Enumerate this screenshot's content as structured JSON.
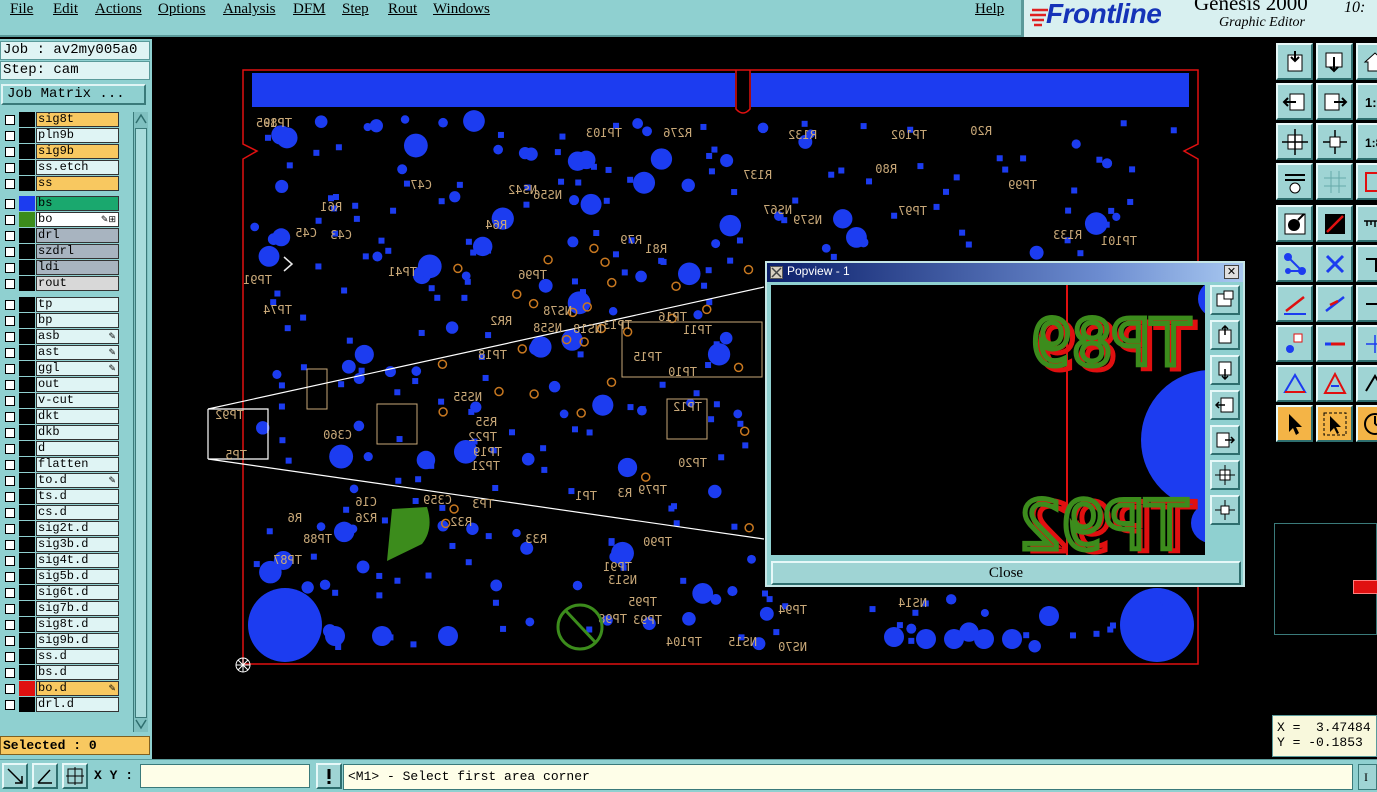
{
  "menu": {
    "items": [
      "File",
      "Edit",
      "Actions",
      "Options",
      "Analysis",
      "DFM",
      "Step",
      "Rout",
      "Windows"
    ],
    "help": "Help"
  },
  "branding": {
    "logo": "Frontline",
    "product": "Genesis 2000",
    "subtitle": "Graphic Editor",
    "clock": "10:"
  },
  "job": {
    "job_line": "Job : av2my005a0",
    "step_line": "Step: cam",
    "matrix_button": "Job Matrix ..."
  },
  "layers": [
    {
      "name": "sig8t",
      "bg": "#f8c860",
      "swatch": "",
      "mark": ""
    },
    {
      "name": "pln9b",
      "bg": "#dff4f4",
      "swatch": "",
      "mark": ""
    },
    {
      "name": "sig9b",
      "bg": "#f8c860",
      "swatch": "",
      "mark": ""
    },
    {
      "name": "ss.etch",
      "bg": "#dff4f4",
      "swatch": "",
      "mark": ""
    },
    {
      "name": "ss",
      "bg": "#f8c860",
      "swatch": "",
      "mark": ""
    },
    {
      "name": "bs",
      "bg": "#1aa86e",
      "swatch": "#1c3cf0",
      "mark": ""
    },
    {
      "name": "bo",
      "bg": "#ffffff",
      "swatch": "#3c8c1c",
      "mark": "✎⊞"
    },
    {
      "name": "drl",
      "bg": "#a8b4c0",
      "swatch": "",
      "mark": ""
    },
    {
      "name": "szdrl",
      "bg": "#a8b4c0",
      "swatch": "",
      "mark": ""
    },
    {
      "name": "ldi",
      "bg": "#a8b4c0",
      "swatch": "",
      "mark": ""
    },
    {
      "name": "rout",
      "bg": "#d8d8d8",
      "swatch": "",
      "mark": ""
    },
    {
      "name": "tp",
      "bg": "#dff4f4",
      "swatch": "",
      "mark": ""
    },
    {
      "name": "bp",
      "bg": "#dff4f4",
      "swatch": "",
      "mark": ""
    },
    {
      "name": "asb",
      "bg": "#dff4f4",
      "swatch": "",
      "mark": "✎"
    },
    {
      "name": "ast",
      "bg": "#dff4f4",
      "swatch": "",
      "mark": "✎"
    },
    {
      "name": "ggl",
      "bg": "#dff4f4",
      "swatch": "",
      "mark": "✎"
    },
    {
      "name": "out",
      "bg": "#dff4f4",
      "swatch": "",
      "mark": ""
    },
    {
      "name": "v-cut",
      "bg": "#dff4f4",
      "swatch": "",
      "mark": ""
    },
    {
      "name": "dkt",
      "bg": "#dff4f4",
      "swatch": "",
      "mark": ""
    },
    {
      "name": "dkb",
      "bg": "#dff4f4",
      "swatch": "",
      "mark": ""
    },
    {
      "name": "d",
      "bg": "#dff4f4",
      "swatch": "",
      "mark": ""
    },
    {
      "name": "flatten",
      "bg": "#dff4f4",
      "swatch": "",
      "mark": ""
    },
    {
      "name": "to.d",
      "bg": "#dff4f4",
      "swatch": "",
      "mark": "✎"
    },
    {
      "name": "ts.d",
      "bg": "#dff4f4",
      "swatch": "",
      "mark": ""
    },
    {
      "name": "cs.d",
      "bg": "#dff4f4",
      "swatch": "",
      "mark": ""
    },
    {
      "name": "sig2t.d",
      "bg": "#dff4f4",
      "swatch": "",
      "mark": ""
    },
    {
      "name": "sig3b.d",
      "bg": "#dff4f4",
      "swatch": "",
      "mark": ""
    },
    {
      "name": "sig4t.d",
      "bg": "#dff4f4",
      "swatch": "",
      "mark": ""
    },
    {
      "name": "sig5b.d",
      "bg": "#dff4f4",
      "swatch": "",
      "mark": ""
    },
    {
      "name": "sig6t.d",
      "bg": "#dff4f4",
      "swatch": "",
      "mark": ""
    },
    {
      "name": "sig7b.d",
      "bg": "#dff4f4",
      "swatch": "",
      "mark": ""
    },
    {
      "name": "sig8t.d",
      "bg": "#dff4f4",
      "swatch": "",
      "mark": ""
    },
    {
      "name": "sig9b.d",
      "bg": "#dff4f4",
      "swatch": "",
      "mark": ""
    },
    {
      "name": "ss.d",
      "bg": "#dff4f4",
      "swatch": "",
      "mark": ""
    },
    {
      "name": "bs.d",
      "bg": "#dff4f4",
      "swatch": "",
      "mark": ""
    },
    {
      "name": "bo.d",
      "bg": "#f8c860",
      "swatch": "#e01010",
      "mark": "✎"
    },
    {
      "name": "drl.d",
      "bg": "#dff4f4",
      "swatch": "",
      "mark": ""
    }
  ],
  "selected": "Selected : 0",
  "board_labels": {
    "top_refs": [
      "TP105",
      "TP103",
      "R276",
      "R132",
      "TP102",
      "R20",
      "R80",
      "TP99",
      "TP97",
      "TP101",
      "R133",
      "R137",
      "NS67",
      "NS79",
      "NS56",
      "NS42",
      "R79",
      "R81",
      "R64",
      "R61",
      "C43",
      "C45",
      "C47",
      "TP91",
      "TP41",
      "TP74",
      "TP96",
      "NS78",
      "NS58",
      "NS18",
      "RR2",
      "TP13",
      "TP16",
      "TP11",
      "TP15",
      "TP10",
      "TP12",
      "TP18",
      "NS55",
      "R55",
      "TP22",
      "TP19",
      "TP21",
      "TP20",
      "TP79",
      "TP1",
      "R3",
      "C16",
      "R26",
      "R32",
      "R33",
      "C359",
      "C360",
      "R6",
      "TP88",
      "TP87",
      "TP90",
      "TP91",
      "NS13",
      "TP95",
      "TP93",
      "TP94",
      "TP98",
      "TP104",
      "NS15",
      "NS14",
      "NS70",
      "TP3",
      "TP5",
      "TP92",
      "TP89"
    ]
  },
  "popview": {
    "title": "Popview - 1",
    "close_label": "Close",
    "zoom_text_1": "TP89",
    "zoom_text_2": "TP92"
  },
  "coords": {
    "x": "X =  3.47484",
    "y": "Y = -0.1853"
  },
  "status": {
    "xy_label": "X Y :",
    "xy_value": "",
    "message": "<M1> - Select first area corner",
    "right_button": "I"
  },
  "colors": {
    "ui_teal": "#8fd0d0",
    "pad_blue": "#1c3cf0",
    "silk_tan": "#c8a878",
    "outline_red": "#e01010",
    "bo_green": "#3c8c1c"
  }
}
